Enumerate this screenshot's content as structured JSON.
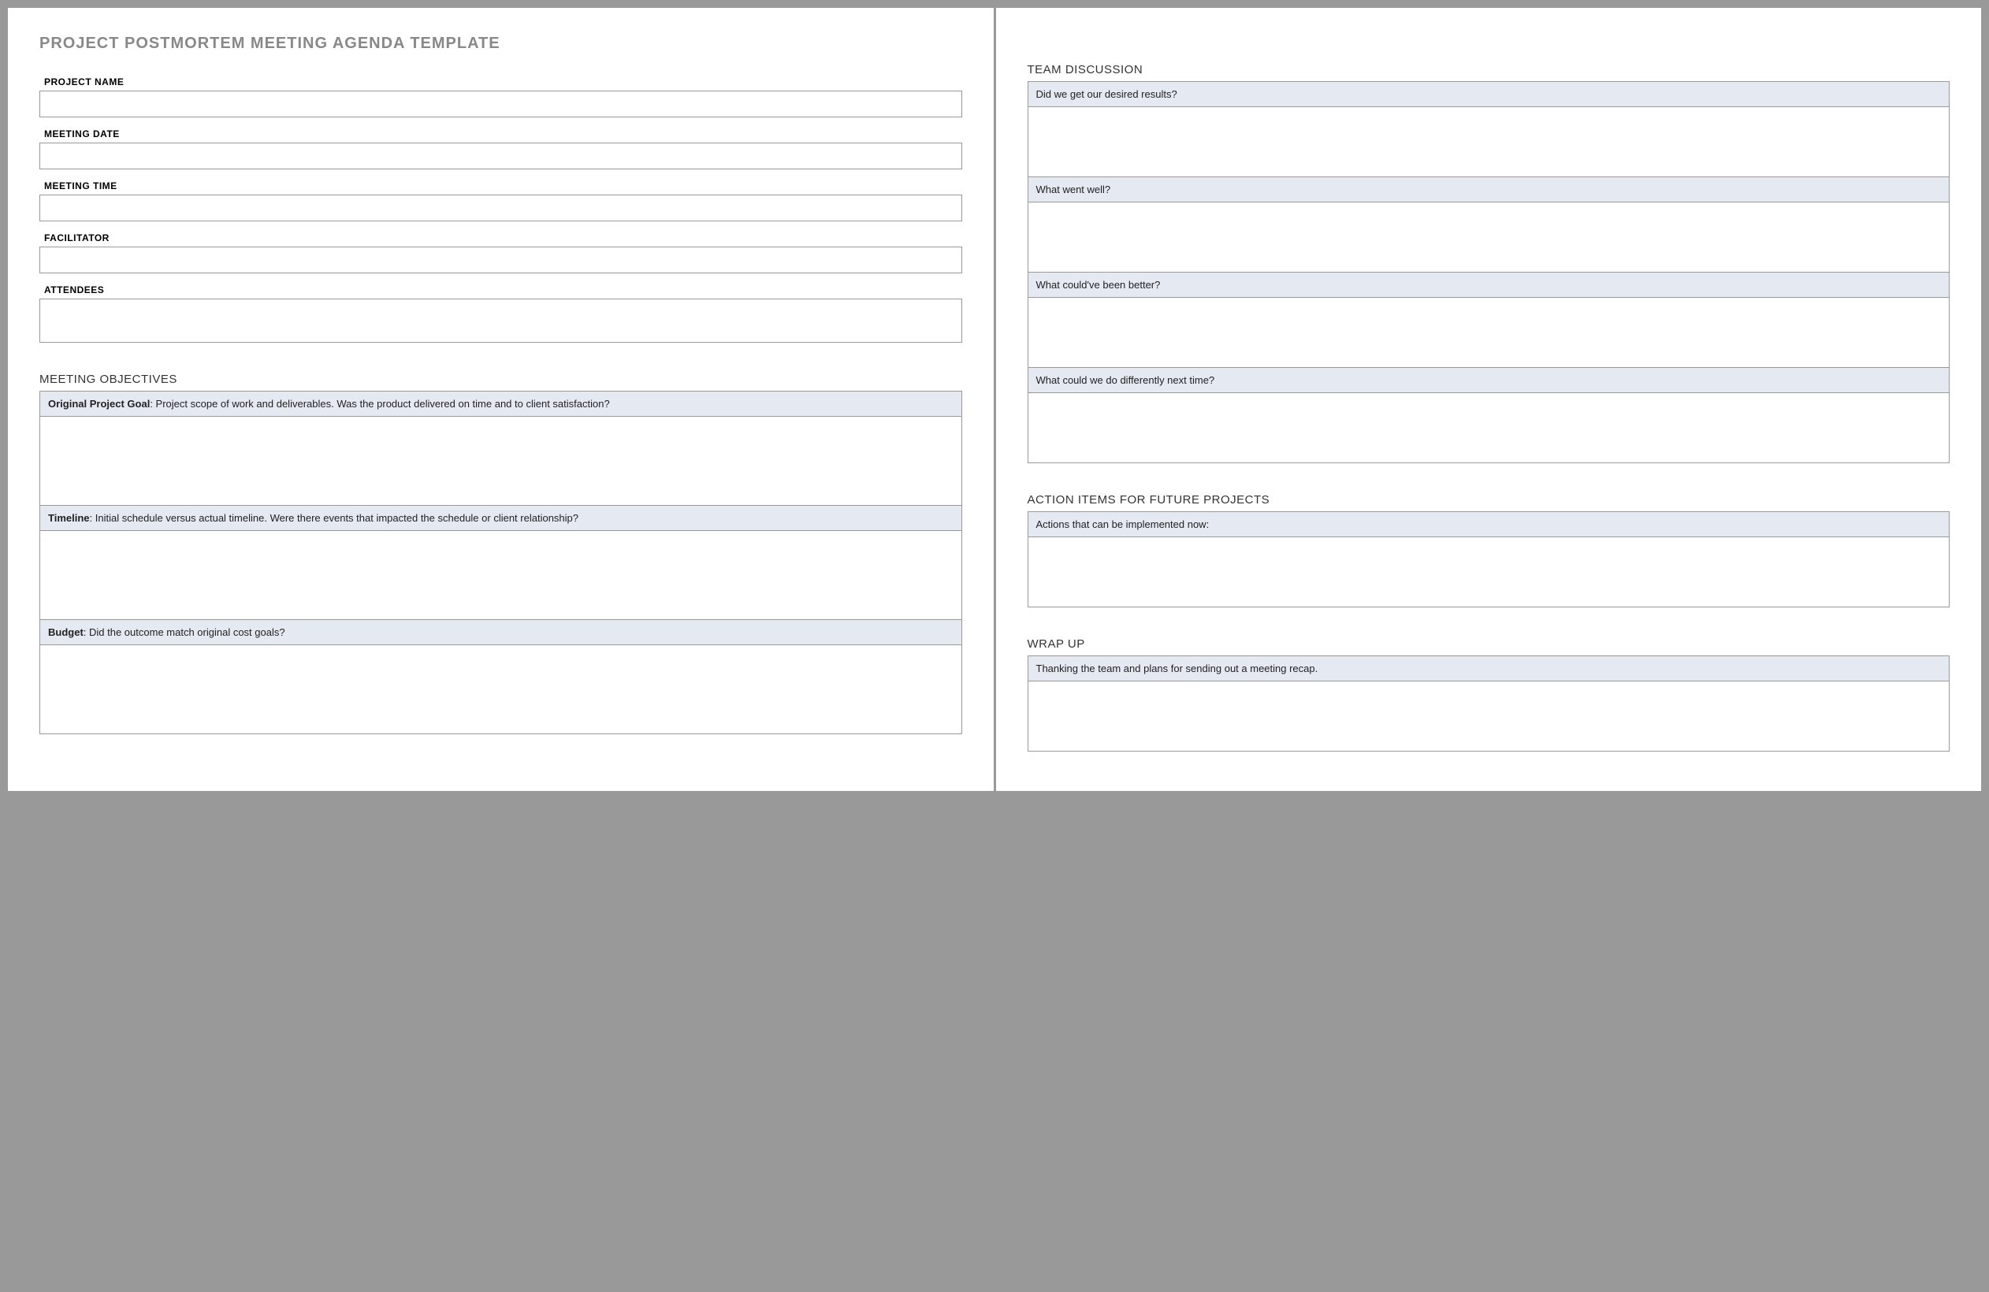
{
  "doc": {
    "title": "PROJECT POSTMORTEM MEETING AGENDA TEMPLATE"
  },
  "fields": {
    "project_name": {
      "label": "PROJECT NAME",
      "value": ""
    },
    "meeting_date": {
      "label": "MEETING DATE",
      "value": ""
    },
    "meeting_time": {
      "label": "MEETING TIME",
      "value": ""
    },
    "facilitator": {
      "label": "FACILITATOR",
      "value": ""
    },
    "attendees": {
      "label": "ATTENDEES",
      "value": ""
    }
  },
  "sections": {
    "objectives": {
      "heading": "MEETING OBJECTIVES",
      "items": [
        {
          "label": "Original Project Goal",
          "text": ": Project scope of work and deliverables. Was the product delivered on time and to client satisfaction?",
          "body": ""
        },
        {
          "label": "Timeline",
          "text": ": Initial schedule versus actual timeline. Were there events that impacted the schedule or client relationship?",
          "body": ""
        },
        {
          "label": "Budget",
          "text": ": Did the outcome match original cost goals?",
          "body": ""
        }
      ]
    },
    "discussion": {
      "heading": "TEAM DISCUSSION",
      "items": [
        {
          "text": "Did we get our desired results?",
          "body": ""
        },
        {
          "text": "What went well?",
          "body": ""
        },
        {
          "text": "What could've been better?",
          "body": ""
        },
        {
          "text": "What could we do differently next time?",
          "body": ""
        }
      ]
    },
    "actions": {
      "heading": "ACTION ITEMS FOR FUTURE PROJECTS",
      "items": [
        {
          "text": "Actions that can be implemented now:",
          "body": ""
        }
      ]
    },
    "wrapup": {
      "heading": "WRAP UP",
      "items": [
        {
          "text": "Thanking the team and plans for sending out a meeting recap.",
          "body": ""
        }
      ]
    }
  }
}
